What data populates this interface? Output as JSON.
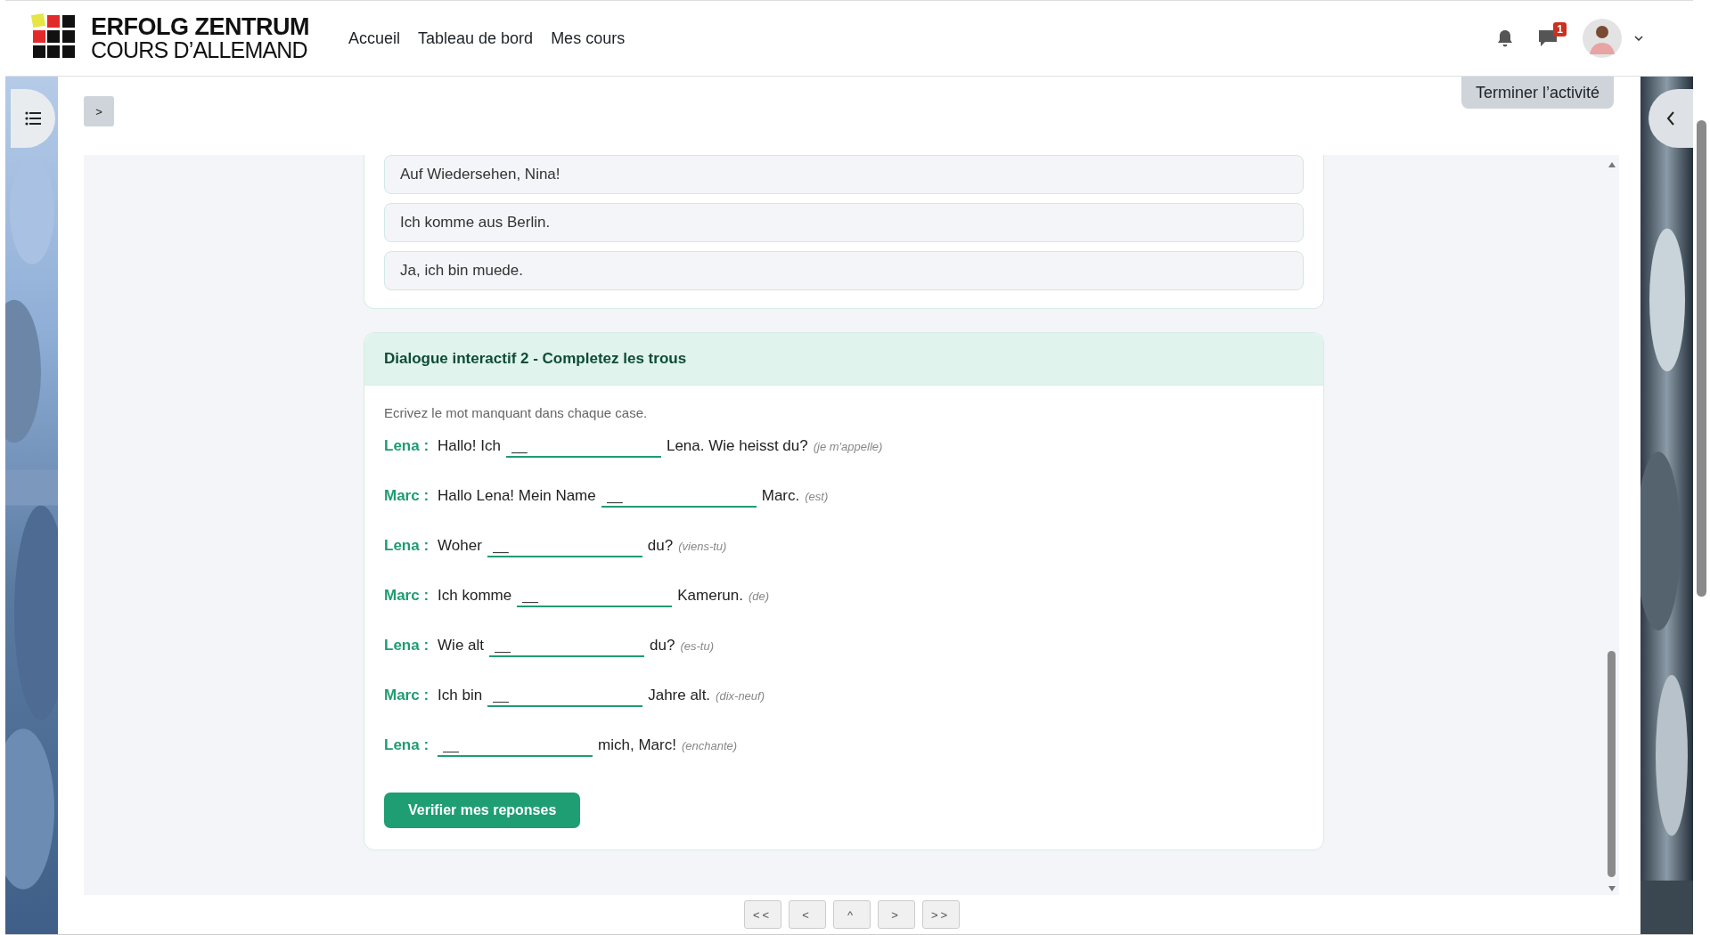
{
  "header": {
    "logo": {
      "title": "ERFOLG ZENTRUM",
      "subtitle": "COURS D’ALLEMAND"
    },
    "nav": [
      "Accueil",
      "Tableau de bord",
      "Mes cours"
    ],
    "messages_badge": "1"
  },
  "complete_button": "Terminer l’activité",
  "drawer_toggle": ">",
  "options": [
    "Auf Wiedersehen, Nina!",
    "Ich komme aus Berlin.",
    "Ja, ich bin muede."
  ],
  "exercise": {
    "title": "Dialogue interactif 2 - Completez les trous",
    "instruction": "Ecrivez le mot manquant dans chaque case.",
    "lines": [
      {
        "speaker": "Lena :",
        "before": "Hallo! Ich",
        "placeholder": "__",
        "after": "Lena. Wie heisst du?",
        "hint": "(je m'appelle)"
      },
      {
        "speaker": "Marc :",
        "before": "Hallo Lena! Mein Name",
        "placeholder": "__",
        "after": "Marc.",
        "hint": "(est)"
      },
      {
        "speaker": "Lena :",
        "before": "Woher",
        "placeholder": "__",
        "after": "du?",
        "hint": "(viens-tu)"
      },
      {
        "speaker": "Marc :",
        "before": "Ich komme",
        "placeholder": "__",
        "after": "Kamerun.",
        "hint": "(de)"
      },
      {
        "speaker": "Lena :",
        "before": "Wie alt",
        "placeholder": "__",
        "after": "du?",
        "hint": "(es-tu)"
      },
      {
        "speaker": "Marc :",
        "before": "Ich bin",
        "placeholder": "__",
        "after": "Jahre alt.",
        "hint": "(dix-neuf)"
      },
      {
        "speaker": "Lena :",
        "placeholder": "__",
        "after": "mich, Marc!",
        "hint": "(enchante)"
      }
    ],
    "submit": "Verifier mes reponses"
  },
  "pagination": [
    "<<",
    "<",
    "^",
    ">",
    ">>"
  ]
}
